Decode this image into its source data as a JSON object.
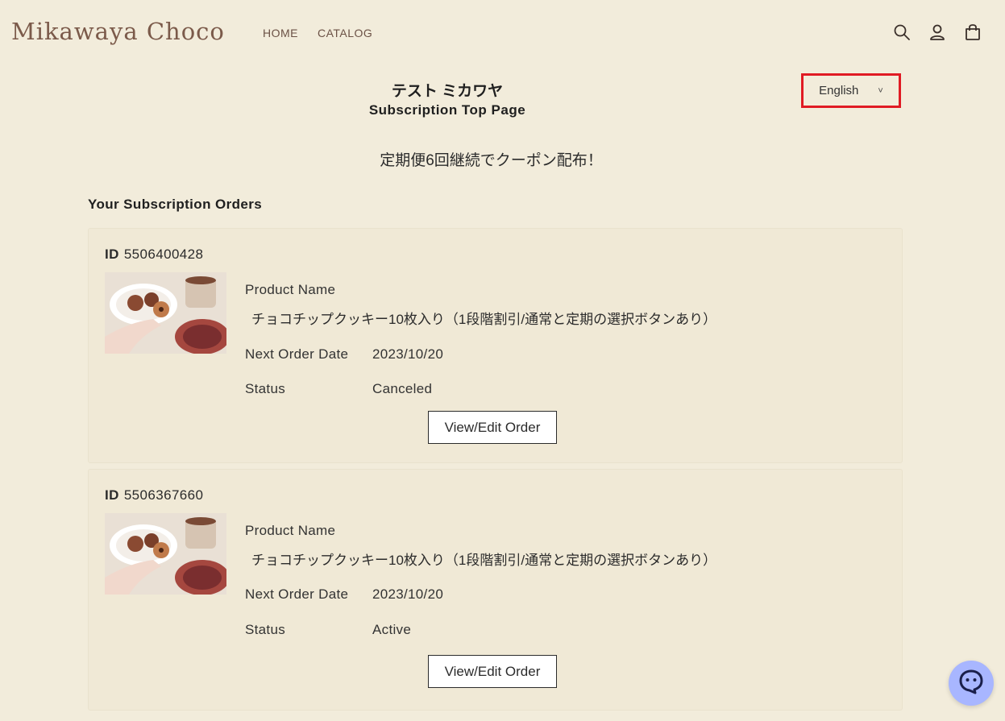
{
  "header": {
    "logo": "Mikawaya Choco",
    "nav": [
      "HOME",
      "CATALOG"
    ],
    "icons": [
      "search-icon",
      "account-icon",
      "cart-icon"
    ]
  },
  "language": {
    "selected": "English"
  },
  "page": {
    "shop_name": "テスト ミカワヤ",
    "title": "Subscription Top Page",
    "announcement": "定期便6回継続でクーポン配布！",
    "section_title": "Your Subscription Orders"
  },
  "labels": {
    "id": "ID",
    "product_name": "Product Name",
    "next_order_date": "Next Order Date",
    "status": "Status",
    "button": "View/Edit Order"
  },
  "orders": [
    {
      "id": "5506400428",
      "product": "チョコチップクッキー10枚入り（1段階割引/通常と定期の選択ボタンあり）",
      "next_order_date": "2023/10/20",
      "status": "Canceled"
    },
    {
      "id": "5506367660",
      "product": "チョコチップクッキー10枚入り（1段階割引/通常と定期の選択ボタンあり）",
      "next_order_date": "2023/10/20",
      "status": "Active"
    }
  ],
  "colors": {
    "background": "#f2ecdb",
    "logo": "#7b5a4a",
    "highlight_border": "#e01b24",
    "chat_bubble": "#a8b6ff"
  }
}
